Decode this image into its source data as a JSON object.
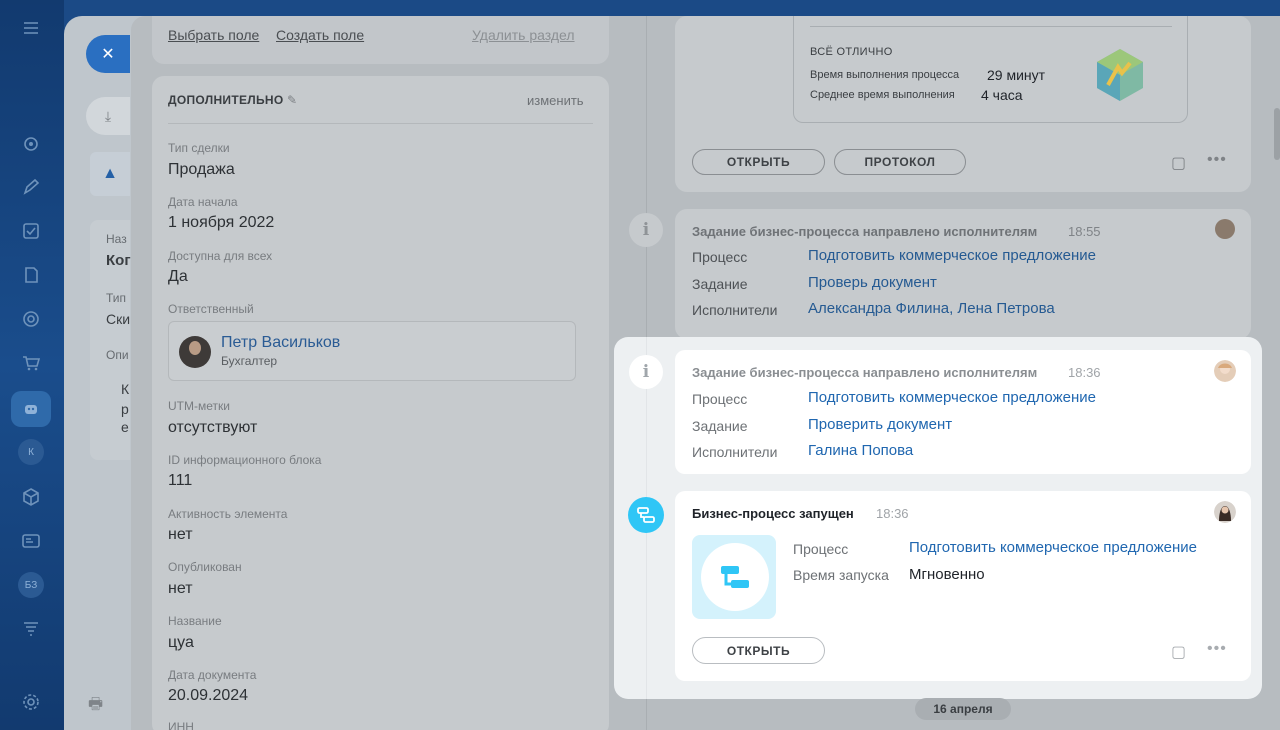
{
  "top_actions": {
    "choose_field": "Выбрать поле",
    "create_field": "Создать поле",
    "delete_section": "Удалить раздел"
  },
  "section": {
    "title": "ДОПОЛНИТЕЛЬНО",
    "change": "изменить"
  },
  "fields": [
    {
      "label": "Тип сделки",
      "value": "Продажа"
    },
    {
      "label": "Дата начала",
      "value": "1 ноября 2022"
    },
    {
      "label": "Доступна для всех",
      "value": "Да"
    },
    {
      "label": "Ответственный",
      "value": ""
    },
    {
      "label": "UTM-метки",
      "value": "отсутствуют"
    },
    {
      "label": "ID информационного блока",
      "value": "111"
    },
    {
      "label": "Активность элемента",
      "value": "нет"
    },
    {
      "label": "Опубликован",
      "value": "нет"
    },
    {
      "label": "Название",
      "value": "цуа"
    },
    {
      "label": "Дата документа",
      "value": "20.09.2024"
    },
    {
      "label": "ИНН",
      "value": ""
    }
  ],
  "responsible": {
    "name": "Петр Васильков",
    "role": "Бухгалтер"
  },
  "mid_layer": {
    "label_1": "Наз",
    "value_1": "Ког",
    "label_2": "Тип",
    "value_2": "Ски",
    "label_3": "Опи",
    "text_1": "К",
    "text_2": "р",
    "text_3": "е"
  },
  "rail": {
    "badge_k": "К",
    "badge_bz": "БЗ"
  },
  "summary_card": {
    "status": "ВСЁ ОТЛИЧНО",
    "exec_time_label": "Время выполнения процесса",
    "exec_time_value": "29 минут",
    "avg_time_label": "Среднее время выполнения",
    "avg_time_value": "4 часа",
    "open_btn": "ОТКРЫТЬ",
    "protocol_btn": "ПРОТОКОЛ"
  },
  "timeline": [
    {
      "title": "Задание бизнес-процесса направлено исполнителям",
      "time": "18:55",
      "process_label": "Процесс",
      "process": "Подготовить коммерческое предложение",
      "task_label": "Задание",
      "task": "Проверь документ",
      "executors_label": "Исполнители",
      "executors": "Александра Филина, Лена Петрова"
    },
    {
      "title": "Задание бизнес-процесса направлено исполнителям",
      "time": "18:36",
      "process_label": "Процесс",
      "process": "Подготовить коммерческое предложение",
      "task_label": "Задание",
      "task": "Проверить документ",
      "executors_label": "Исполнители",
      "executors": "Галина Попова"
    },
    {
      "title": "Бизнес-процесс запущен",
      "time": "18:36",
      "process_label": "Процесс",
      "process": "Подготовить коммерческое предложение",
      "launch_label": "Время запуска",
      "launch": "Мгновенно",
      "open_btn": "ОТКРЫТЬ"
    }
  ],
  "date_separator": "16 апреля",
  "colors": {
    "accent": "#2fc6f6",
    "link": "#2067b0",
    "sidebar": "#123a6f"
  }
}
